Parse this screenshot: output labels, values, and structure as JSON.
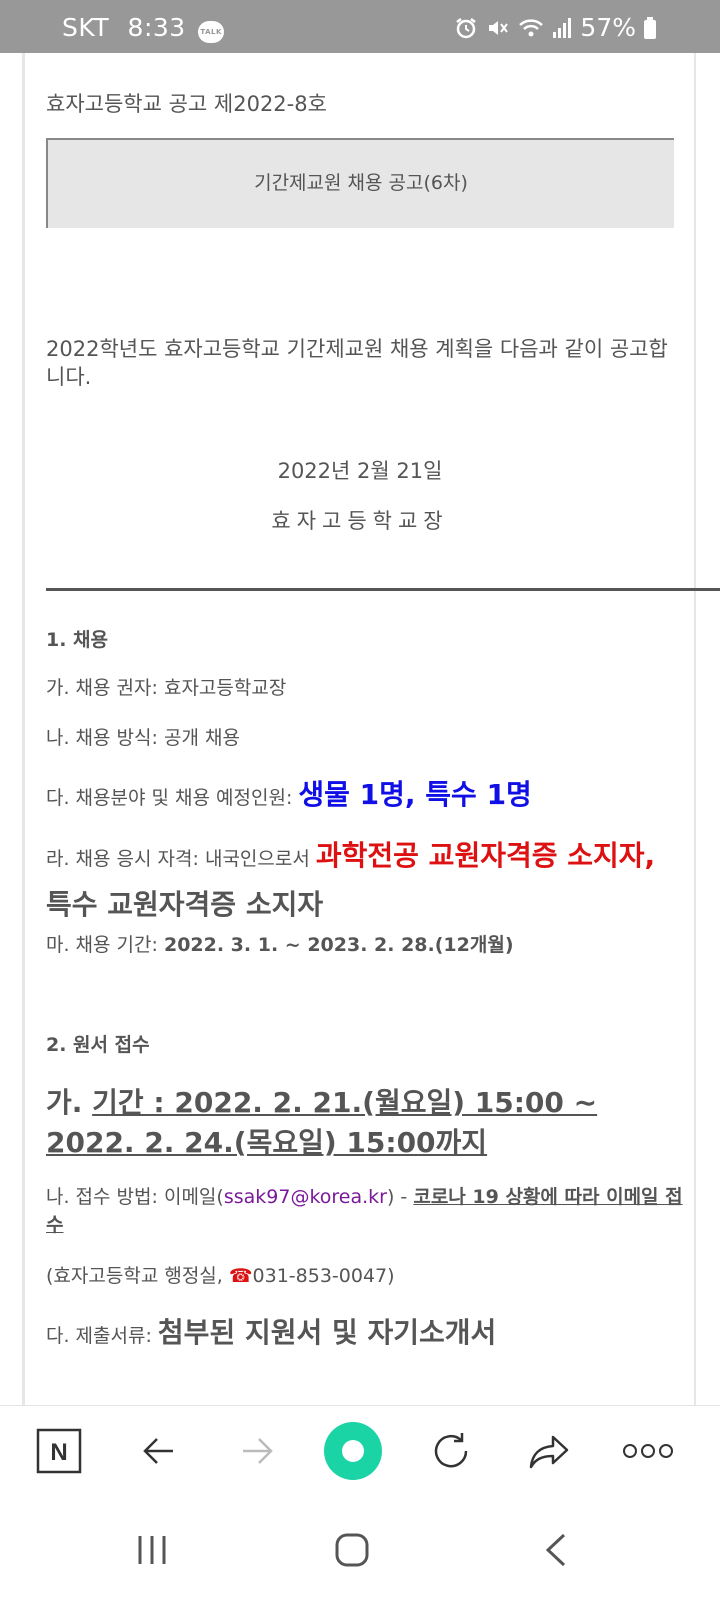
{
  "status_bar": {
    "carrier": "SKT",
    "time": "8:33",
    "talk_badge": "TALK",
    "battery": "57%",
    "icons": [
      "alarm-icon",
      "mute-icon",
      "wifi-icon",
      "signal-icon",
      "battery-icon"
    ]
  },
  "notice": {
    "number": "효자고등학교 공고 제2022-8호",
    "title": "기간제교원 채용 공고(6차)",
    "intro": "2022학년도 효자고등학교 기간제교원 채용 계획을 다음과 같이 공고합니다.",
    "date": "2022년 2월 21일",
    "principal": "효자고등학교장"
  },
  "section1": {
    "heading": "1. 채용",
    "ga": "가. 채용 권자: 효자고등학교장",
    "na": "나. 채용 방식: 공개 채용",
    "da_label": "다. 채용분야 및 채용 예정인원: ",
    "da_value": "생물 1명, 특수 1명",
    "ra_label": "라. 채용 응시 자격: 내국인으로서 ",
    "ra_red": "과학전공 교원자격증 소지자,",
    "ra_rest": " 특수 교원자격증 소지자",
    "ma_label": "마. 채용 기간: ",
    "ma_value": "2022. 3. 1. ~ 2023. 2. 28.(12개월)"
  },
  "section2": {
    "heading": "2. 원서 접수",
    "period_prefix": "가. ",
    "period_value": "기간 : 2022. 2. 21.(월요일) 15:00 ∼ 2022. 2. 24.(목요일) 15:00까지",
    "method_label": "나. 접수 방법: 이메일(",
    "method_email": "ssak97@korea.kr",
    "method_mid": ") - ",
    "method_note": "코로나 19 상황에 따라 이메일 접수",
    "office_prefix": "(효자고등학교 행정실, ",
    "office_phone_icon": "☎",
    "office_phone": "031-853-0047)",
    "docs_label": "다. 제출서류: ",
    "docs_value": "첨부된 지원서 및 자기소개서"
  },
  "toolbar": {
    "naver_label": "N",
    "icons": [
      "naver-icon",
      "back-arrow-icon",
      "forward-arrow-icon",
      "green-dot-icon",
      "refresh-icon",
      "share-icon",
      "more-icon"
    ],
    "colors": {
      "green_dot": "#1ad4a6",
      "disabled": "#bbbbbb",
      "icon": "#333333"
    }
  },
  "colors": {
    "status_bar": "#989898",
    "blue_text": "#1010e6",
    "red_text": "#dd1111",
    "title_box": "#e6e6e6",
    "email": "#7a1a9a"
  }
}
